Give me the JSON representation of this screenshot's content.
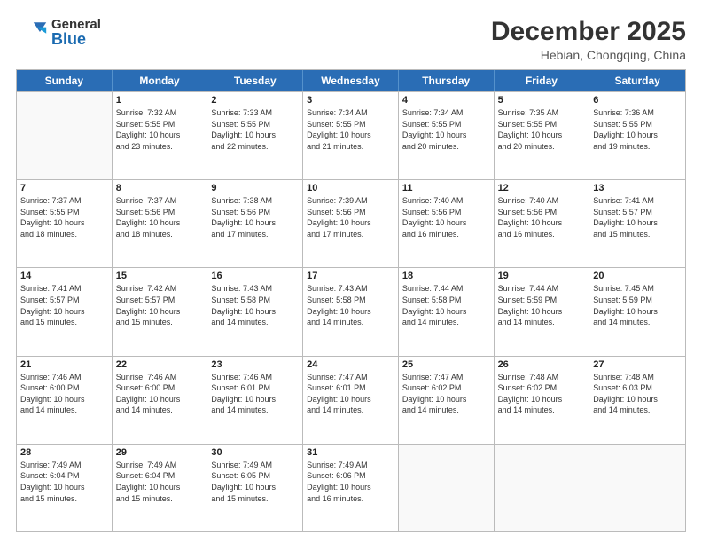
{
  "header": {
    "logo_general": "General",
    "logo_blue": "Blue",
    "month_title": "December 2025",
    "location": "Hebian, Chongqing, China"
  },
  "weekdays": [
    "Sunday",
    "Monday",
    "Tuesday",
    "Wednesday",
    "Thursday",
    "Friday",
    "Saturday"
  ],
  "rows": [
    [
      {
        "day": "",
        "info": ""
      },
      {
        "day": "1",
        "info": "Sunrise: 7:32 AM\nSunset: 5:55 PM\nDaylight: 10 hours\nand 23 minutes."
      },
      {
        "day": "2",
        "info": "Sunrise: 7:33 AM\nSunset: 5:55 PM\nDaylight: 10 hours\nand 22 minutes."
      },
      {
        "day": "3",
        "info": "Sunrise: 7:34 AM\nSunset: 5:55 PM\nDaylight: 10 hours\nand 21 minutes."
      },
      {
        "day": "4",
        "info": "Sunrise: 7:34 AM\nSunset: 5:55 PM\nDaylight: 10 hours\nand 20 minutes."
      },
      {
        "day": "5",
        "info": "Sunrise: 7:35 AM\nSunset: 5:55 PM\nDaylight: 10 hours\nand 20 minutes."
      },
      {
        "day": "6",
        "info": "Sunrise: 7:36 AM\nSunset: 5:55 PM\nDaylight: 10 hours\nand 19 minutes."
      }
    ],
    [
      {
        "day": "7",
        "info": "Sunrise: 7:37 AM\nSunset: 5:55 PM\nDaylight: 10 hours\nand 18 minutes."
      },
      {
        "day": "8",
        "info": "Sunrise: 7:37 AM\nSunset: 5:56 PM\nDaylight: 10 hours\nand 18 minutes."
      },
      {
        "day": "9",
        "info": "Sunrise: 7:38 AM\nSunset: 5:56 PM\nDaylight: 10 hours\nand 17 minutes."
      },
      {
        "day": "10",
        "info": "Sunrise: 7:39 AM\nSunset: 5:56 PM\nDaylight: 10 hours\nand 17 minutes."
      },
      {
        "day": "11",
        "info": "Sunrise: 7:40 AM\nSunset: 5:56 PM\nDaylight: 10 hours\nand 16 minutes."
      },
      {
        "day": "12",
        "info": "Sunrise: 7:40 AM\nSunset: 5:56 PM\nDaylight: 10 hours\nand 16 minutes."
      },
      {
        "day": "13",
        "info": "Sunrise: 7:41 AM\nSunset: 5:57 PM\nDaylight: 10 hours\nand 15 minutes."
      }
    ],
    [
      {
        "day": "14",
        "info": "Sunrise: 7:41 AM\nSunset: 5:57 PM\nDaylight: 10 hours\nand 15 minutes."
      },
      {
        "day": "15",
        "info": "Sunrise: 7:42 AM\nSunset: 5:57 PM\nDaylight: 10 hours\nand 15 minutes."
      },
      {
        "day": "16",
        "info": "Sunrise: 7:43 AM\nSunset: 5:58 PM\nDaylight: 10 hours\nand 14 minutes."
      },
      {
        "day": "17",
        "info": "Sunrise: 7:43 AM\nSunset: 5:58 PM\nDaylight: 10 hours\nand 14 minutes."
      },
      {
        "day": "18",
        "info": "Sunrise: 7:44 AM\nSunset: 5:58 PM\nDaylight: 10 hours\nand 14 minutes."
      },
      {
        "day": "19",
        "info": "Sunrise: 7:44 AM\nSunset: 5:59 PM\nDaylight: 10 hours\nand 14 minutes."
      },
      {
        "day": "20",
        "info": "Sunrise: 7:45 AM\nSunset: 5:59 PM\nDaylight: 10 hours\nand 14 minutes."
      }
    ],
    [
      {
        "day": "21",
        "info": "Sunrise: 7:46 AM\nSunset: 6:00 PM\nDaylight: 10 hours\nand 14 minutes."
      },
      {
        "day": "22",
        "info": "Sunrise: 7:46 AM\nSunset: 6:00 PM\nDaylight: 10 hours\nand 14 minutes."
      },
      {
        "day": "23",
        "info": "Sunrise: 7:46 AM\nSunset: 6:01 PM\nDaylight: 10 hours\nand 14 minutes."
      },
      {
        "day": "24",
        "info": "Sunrise: 7:47 AM\nSunset: 6:01 PM\nDaylight: 10 hours\nand 14 minutes."
      },
      {
        "day": "25",
        "info": "Sunrise: 7:47 AM\nSunset: 6:02 PM\nDaylight: 10 hours\nand 14 minutes."
      },
      {
        "day": "26",
        "info": "Sunrise: 7:48 AM\nSunset: 6:02 PM\nDaylight: 10 hours\nand 14 minutes."
      },
      {
        "day": "27",
        "info": "Sunrise: 7:48 AM\nSunset: 6:03 PM\nDaylight: 10 hours\nand 14 minutes."
      }
    ],
    [
      {
        "day": "28",
        "info": "Sunrise: 7:49 AM\nSunset: 6:04 PM\nDaylight: 10 hours\nand 15 minutes."
      },
      {
        "day": "29",
        "info": "Sunrise: 7:49 AM\nSunset: 6:04 PM\nDaylight: 10 hours\nand 15 minutes."
      },
      {
        "day": "30",
        "info": "Sunrise: 7:49 AM\nSunset: 6:05 PM\nDaylight: 10 hours\nand 15 minutes."
      },
      {
        "day": "31",
        "info": "Sunrise: 7:49 AM\nSunset: 6:06 PM\nDaylight: 10 hours\nand 16 minutes."
      },
      {
        "day": "",
        "info": ""
      },
      {
        "day": "",
        "info": ""
      },
      {
        "day": "",
        "info": ""
      }
    ]
  ]
}
